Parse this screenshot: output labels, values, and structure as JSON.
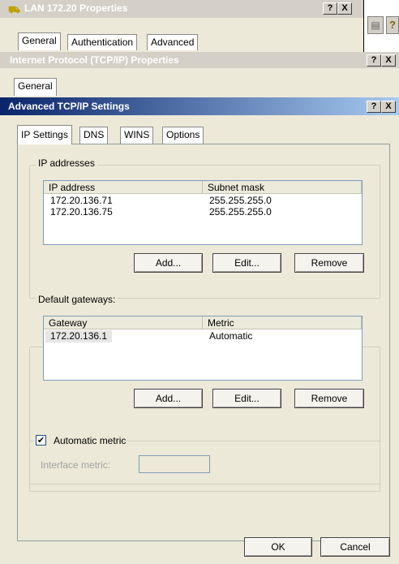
{
  "lan_window": {
    "title": "LAN 172.20 Properties",
    "tabs": [
      "General",
      "Authentication",
      "Advanced"
    ]
  },
  "tcpip_window": {
    "title": "Internet Protocol (TCP/IP) Properties",
    "tabs": [
      "General"
    ]
  },
  "advanced_window": {
    "title": "Advanced TCP/IP Settings",
    "help_button": "?",
    "close_button": "X",
    "tabs": [
      "IP Settings",
      "DNS",
      "WINS",
      "Options"
    ],
    "ip_addresses": {
      "legend": "IP addresses",
      "columns": [
        "IP address",
        "Subnet mask"
      ],
      "rows": [
        {
          "ip": "172.20.136.71",
          "mask": "255.255.255.0"
        },
        {
          "ip": "172.20.136.75",
          "mask": "255.255.255.0"
        }
      ],
      "add_label": "Add...",
      "edit_label": "Edit...",
      "remove_label": "Remove"
    },
    "gateways": {
      "legend": "Default gateways:",
      "columns": [
        "Gateway",
        "Metric"
      ],
      "rows": [
        {
          "gateway": "172.20.136.1",
          "metric": "Automatic"
        }
      ],
      "add_label": "Add...",
      "edit_label": "Edit...",
      "remove_label": "Remove"
    },
    "automatic_metric": {
      "label": "Automatic metric",
      "checked": true,
      "interface_metric_label": "Interface metric:",
      "interface_metric_value": ""
    },
    "ok_label": "OK",
    "cancel_label": "Cancel"
  },
  "colors": {
    "active_title_start": "#0a246a",
    "active_title_end": "#a6caf0",
    "inactive_title": "#d4d0c8",
    "dialog_bg": "#ece9d8"
  }
}
